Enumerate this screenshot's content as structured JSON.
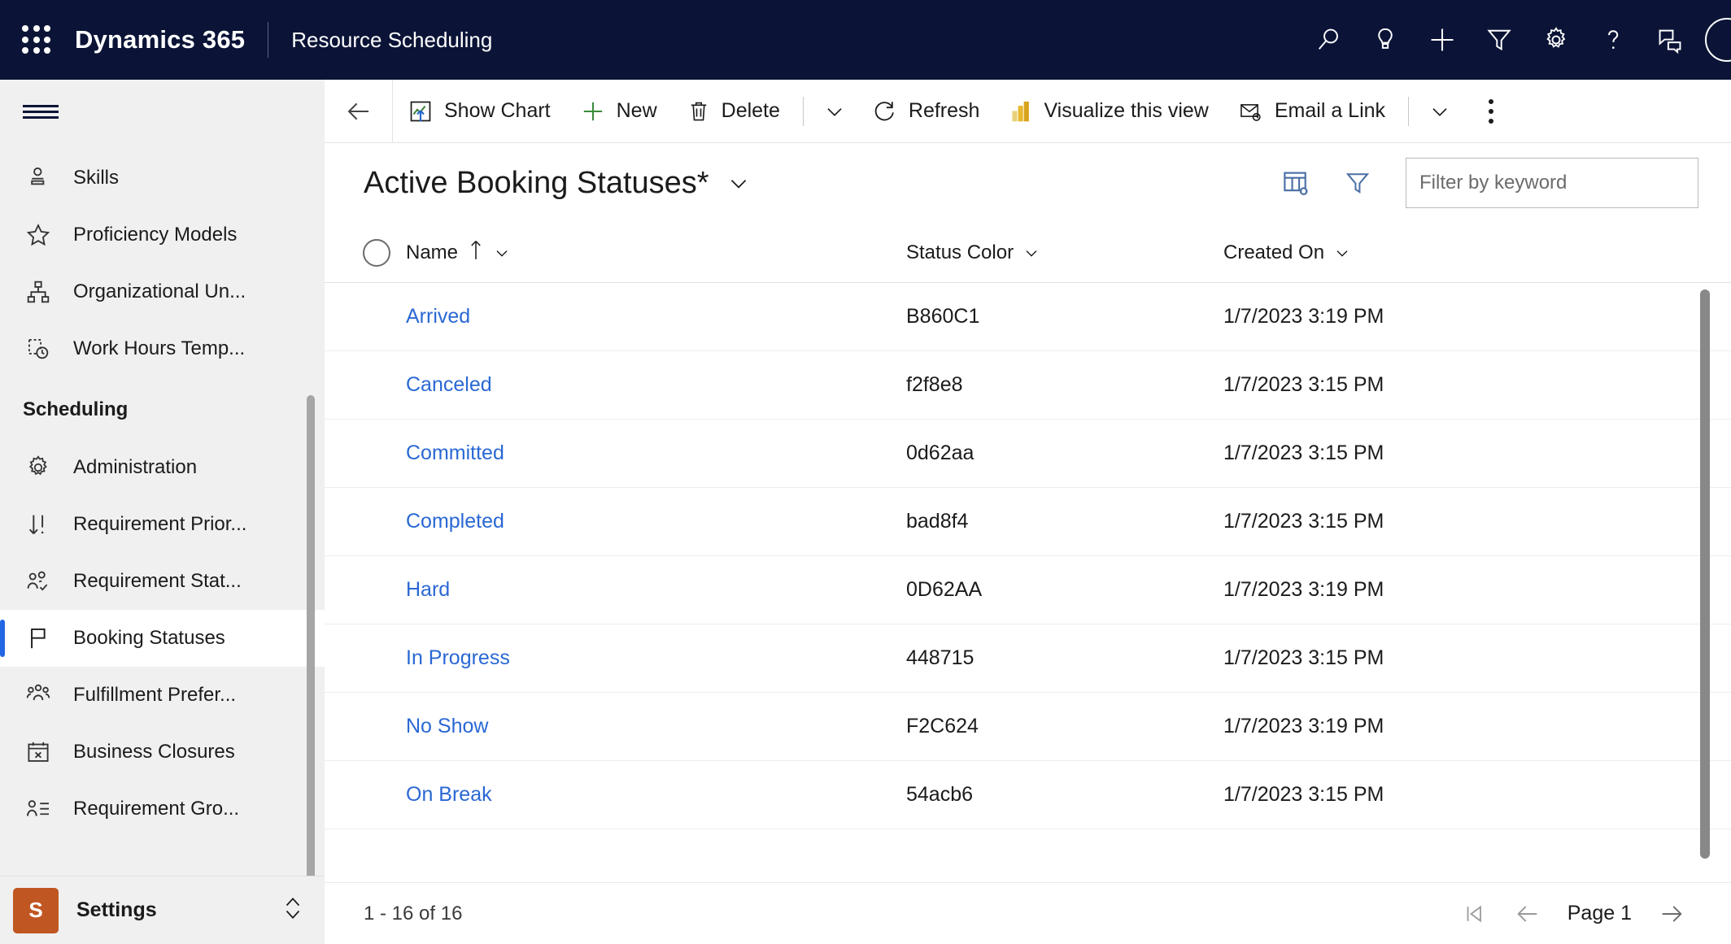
{
  "appbar": {
    "waffle_icon": "app-launcher-icon",
    "brand": "Dynamics 365",
    "app_title": "Resource Scheduling",
    "icons": [
      {
        "name": "search-icon",
        "label": "Search"
      },
      {
        "name": "lightbulb-icon",
        "label": "Tips"
      },
      {
        "name": "plus-icon",
        "label": "Quick create"
      },
      {
        "name": "filter-icon",
        "label": "Filters"
      },
      {
        "name": "gear-icon",
        "label": "Settings"
      },
      {
        "name": "question-icon",
        "label": "Help"
      },
      {
        "name": "feedback-icon",
        "label": "Feedback"
      }
    ],
    "avatar": "user-avatar"
  },
  "sidebar": {
    "hamburger_label": "Site map",
    "items_top": [
      {
        "label": "Skills",
        "icon": "person-card-icon"
      },
      {
        "label": "Proficiency Models",
        "icon": "star-icon"
      },
      {
        "label": "Organizational Un...",
        "icon": "org-chart-icon"
      },
      {
        "label": "Work Hours Temp...",
        "icon": "work-hours-icon"
      }
    ],
    "group_label": "Scheduling",
    "items_group": [
      {
        "label": "Administration",
        "icon": "gear-icon",
        "selected": false
      },
      {
        "label": "Requirement Prior...",
        "icon": "sort-priority-icon",
        "selected": false
      },
      {
        "label": "Requirement Stat...",
        "icon": "people-check-icon",
        "selected": false
      },
      {
        "label": "Booking Statuses",
        "icon": "flag-icon",
        "selected": true
      },
      {
        "label": "Fulfillment Prefer...",
        "icon": "people-group-icon",
        "selected": false
      },
      {
        "label": "Business Closures",
        "icon": "calendar-x-icon",
        "selected": false
      },
      {
        "label": "Requirement Gro...",
        "icon": "person-list-icon",
        "selected": false
      }
    ],
    "settings": {
      "badge": "S",
      "label": "Settings",
      "chevron_icon": "updown-chevron-icon"
    }
  },
  "commandbar": {
    "back_icon": "back-arrow-icon",
    "buttons": [
      {
        "label": "Show Chart",
        "icon": "show-chart-icon"
      },
      {
        "label": "New",
        "icon": "plus-icon"
      },
      {
        "label": "Delete",
        "icon": "trash-icon"
      },
      {
        "label": "Refresh",
        "icon": "refresh-icon"
      },
      {
        "label": "Visualize this view",
        "icon": "powerbi-icon"
      },
      {
        "label": "Email a Link",
        "icon": "email-link-icon"
      }
    ],
    "overflow_icon": "more-vertical-icon",
    "chevron_icon": "chevron-down-icon"
  },
  "view": {
    "title": "Active Booking Statuses*",
    "title_chevron": "chevron-down-icon",
    "edit_columns_icon": "edit-columns-icon",
    "edit_filters_icon": "funnel-filter-icon",
    "search": {
      "placeholder": "Filter by keyword",
      "value": ""
    }
  },
  "grid": {
    "columns": [
      {
        "label": "Name",
        "sort": "asc",
        "sort_icon": "arrow-up-icon",
        "chevron": "chevron-down-icon"
      },
      {
        "label": "Status Color",
        "sort": "",
        "chevron": "chevron-down-icon"
      },
      {
        "label": "Created On",
        "sort": "",
        "chevron": "chevron-down-icon"
      }
    ],
    "select_all_icon": "select-all-circle-icon",
    "rows": [
      {
        "name": "Arrived",
        "status_color": "B860C1",
        "created_on": "1/7/2023 3:19 PM"
      },
      {
        "name": "Canceled",
        "status_color": "f2f8e8",
        "created_on": "1/7/2023 3:15 PM"
      },
      {
        "name": "Committed",
        "status_color": "0d62aa",
        "created_on": "1/7/2023 3:15 PM"
      },
      {
        "name": "Completed",
        "status_color": "bad8f4",
        "created_on": "1/7/2023 3:15 PM"
      },
      {
        "name": "Hard",
        "status_color": "0D62AA",
        "created_on": "1/7/2023 3:19 PM"
      },
      {
        "name": "In Progress",
        "status_color": "448715",
        "created_on": "1/7/2023 3:15 PM"
      },
      {
        "name": "No Show",
        "status_color": "F2C624",
        "created_on": "1/7/2023 3:19 PM"
      },
      {
        "name": "On Break",
        "status_color": "54acb6",
        "created_on": "1/7/2023 3:15 PM"
      }
    ]
  },
  "footer": {
    "record_count": "1 - 16 of 16",
    "page_label": "Page 1",
    "first_icon": "first-page-icon",
    "prev_icon": "previous-page-icon",
    "next_icon": "next-page-icon"
  },
  "colors": {
    "appbar_bg": "#0b1437",
    "accent_link": "#2a68d4",
    "selected_bar": "#2266e3",
    "settings_badge": "#c05621",
    "sidebar_bg": "#f0f0f0"
  }
}
